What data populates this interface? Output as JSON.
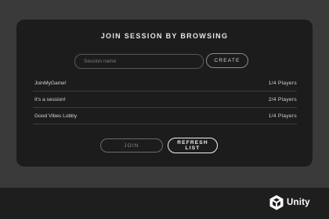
{
  "panel": {
    "title": "JOIN SESSION BY BROWSING"
  },
  "form": {
    "session_name_placeholder": "Session name",
    "create_label": "CREATE"
  },
  "sessions": [
    {
      "name": "JoinMyGame!",
      "players": "1/4 Players"
    },
    {
      "name": "It's a session!",
      "players": "2/4 Players"
    },
    {
      "name": "Good Vibes Lobby",
      "players": "1/4 Players"
    }
  ],
  "actions": {
    "join_label": "JOIN",
    "refresh_label": "REFRESH\nLIST"
  },
  "branding": {
    "logo_text": "Unity",
    "logo_icon": "unity-cube-icon"
  },
  "colors": {
    "page_background": "#3a3a3a",
    "panel_background": "#1c1c1c",
    "bottom_bar": "#1e1e1e"
  }
}
